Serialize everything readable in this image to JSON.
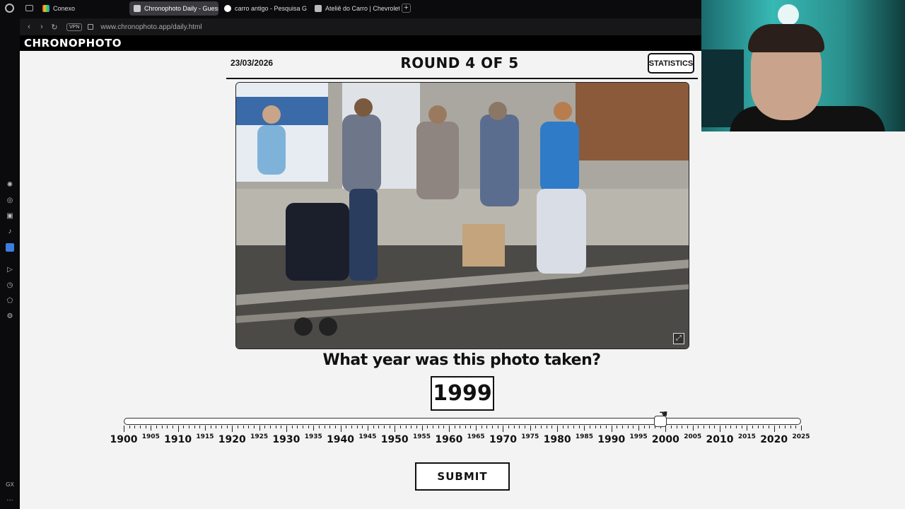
{
  "browser": {
    "tabs": [
      {
        "label": "Conexo",
        "active": false,
        "favicon_color": "#7c5cd6"
      },
      {
        "label": "Chronophoto Daily - Guess",
        "active": true,
        "favicon_color": "#cccccc"
      },
      {
        "label": "carro antigo - Pesquisa G",
        "active": false,
        "favicon_color": "#ffffff"
      },
      {
        "label": "Ateliê do Carro | Chevrolet",
        "active": false,
        "favicon_color": "#cccccc"
      }
    ],
    "url": "www.chronophoto.app/daily.html",
    "vpn_label": "VPN",
    "sidebar_bottom_label": "GX"
  },
  "site": {
    "brand": "CHRONOPHOTO"
  },
  "game": {
    "date": "23/03/2026",
    "round_title": "ROUND 4 OF 5",
    "statistics_label": "STATISTICS",
    "question": "What year was this photo taken?",
    "selected_year": "1999",
    "submit_label": "SUBMIT",
    "slider": {
      "min": 1900,
      "max": 2025,
      "value": 1999,
      "major_labels": [
        "1900",
        "1910",
        "1920",
        "1930",
        "1940",
        "1950",
        "1960",
        "1970",
        "1980",
        "1990",
        "2000",
        "2010",
        "2020"
      ],
      "minor_labels": [
        "1905",
        "1915",
        "1925",
        "1935",
        "1945",
        "1955",
        "1965",
        "1975",
        "1985",
        "1995",
        "2005",
        "2015",
        "2025"
      ]
    }
  }
}
